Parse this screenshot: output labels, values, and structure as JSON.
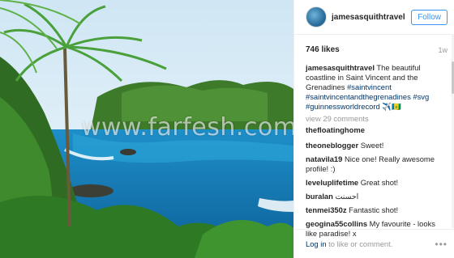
{
  "watermark": "www.farfesh.com",
  "header": {
    "username": "jamesasquithtravel",
    "follow_label": "Follow"
  },
  "stats": {
    "likes": "746 likes",
    "age": "1w"
  },
  "caption": {
    "author": "jamesasquithtravel",
    "text": "The beautiful coastline in Saint Vincent and the Grenadines",
    "tags": [
      "#saintvincent",
      "#saintvincentandthegrenadines",
      "#svg",
      "#guinnessworldrecord"
    ],
    "trailing": "✈️🇻🇨"
  },
  "view_all": "view 29 comments",
  "partial_comment": {
    "user": "thefloatinghome",
    "text": ""
  },
  "comments": [
    {
      "user": "theonebIogger",
      "text": "Sweet!"
    },
    {
      "user": "natavila19",
      "text": "Nice one! Really awesome profile! :)"
    },
    {
      "user": "leveluplifetime",
      "text": "Great shot!"
    },
    {
      "user": "buralan",
      "text": "احسنت"
    },
    {
      "user": "tenmei350z",
      "text": "Fantastic shot!"
    },
    {
      "user": "geogina55collins",
      "text": "My favourite - looks like paradise! x"
    }
  ],
  "footer": {
    "login_link": "Log in",
    "login_rest": "to like or comment.",
    "more_icon": "•••"
  },
  "colors": {
    "accent": "#3897f0",
    "link": "#003569",
    "muted": "#999999"
  }
}
